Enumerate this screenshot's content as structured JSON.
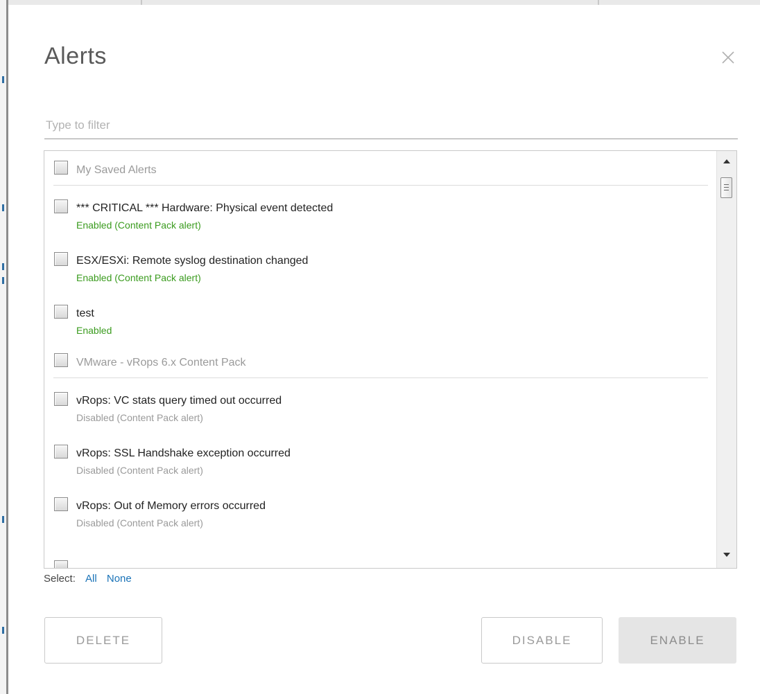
{
  "dialog": {
    "title": "Alerts",
    "close_icon": "close-icon"
  },
  "filter": {
    "value": "",
    "placeholder": "Type to filter"
  },
  "alert_list": {
    "groups": [
      {
        "label": "My Saved Alerts",
        "alerts": [
          {
            "title": "*** CRITICAL *** Hardware: Physical event detected",
            "status": "Enabled (Content Pack alert)",
            "state": "enabled"
          },
          {
            "title": "ESX/ESXi: Remote syslog destination changed",
            "status": "Enabled (Content Pack alert)",
            "state": "enabled"
          },
          {
            "title": "test",
            "status": "Enabled",
            "state": "enabled"
          }
        ]
      },
      {
        "label": "VMware - vRops 6.x Content Pack",
        "alerts": [
          {
            "title": "vRops: VC stats query timed out occurred",
            "status": "Disabled (Content Pack alert)",
            "state": "disabled"
          },
          {
            "title": "vRops: SSL Handshake exception occurred",
            "status": "Disabled (Content Pack alert)",
            "state": "disabled"
          },
          {
            "title": "vRops: Out of Memory errors occurred",
            "status": "Disabled (Content Pack alert)",
            "state": "disabled"
          }
        ]
      }
    ]
  },
  "select_controls": {
    "label": "Select:",
    "all": "All",
    "none": "None"
  },
  "buttons": {
    "delete": "DELETE",
    "disable": "DISABLE",
    "enable": "ENABLE"
  },
  "colors": {
    "enabled_status": "#3a9b1e",
    "disabled_status": "#9a9a9a",
    "link": "#1a73b8"
  }
}
